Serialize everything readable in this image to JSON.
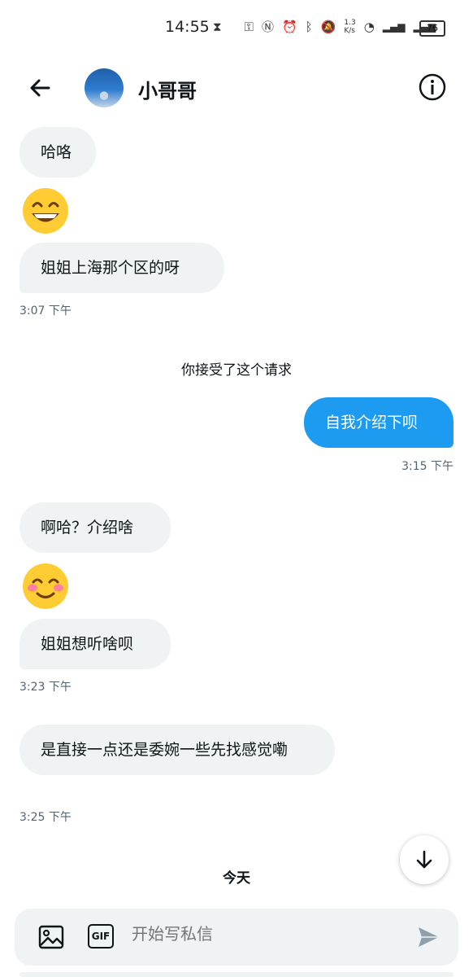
{
  "status": {
    "time": "14:55",
    "speed": "1.3\nK/s",
    "battery": "76"
  },
  "header": {
    "title": "小哥哥"
  },
  "messages": {
    "m1": "哈咯",
    "m2": "姐姐上海那个区的呀",
    "ts1": "3:07 下午",
    "system": "你接受了这个请求",
    "out1": "自我介绍下呗",
    "ts2": "3:15 下午",
    "m3": "啊哈？介绍啥",
    "m4": "姐姐想听啥呗",
    "ts3": "3:23 下午",
    "m5": "是直接一点还是委婉一些先找感觉嘞",
    "ts4": "3:25 下午"
  },
  "divider": {
    "today": "今天"
  },
  "composer": {
    "placeholder": "开始写私信",
    "gif_label": "GIF"
  },
  "colors": {
    "accent": "#1d9bf0",
    "bubble_in": "#eff3f4",
    "text_secondary": "#536471"
  }
}
